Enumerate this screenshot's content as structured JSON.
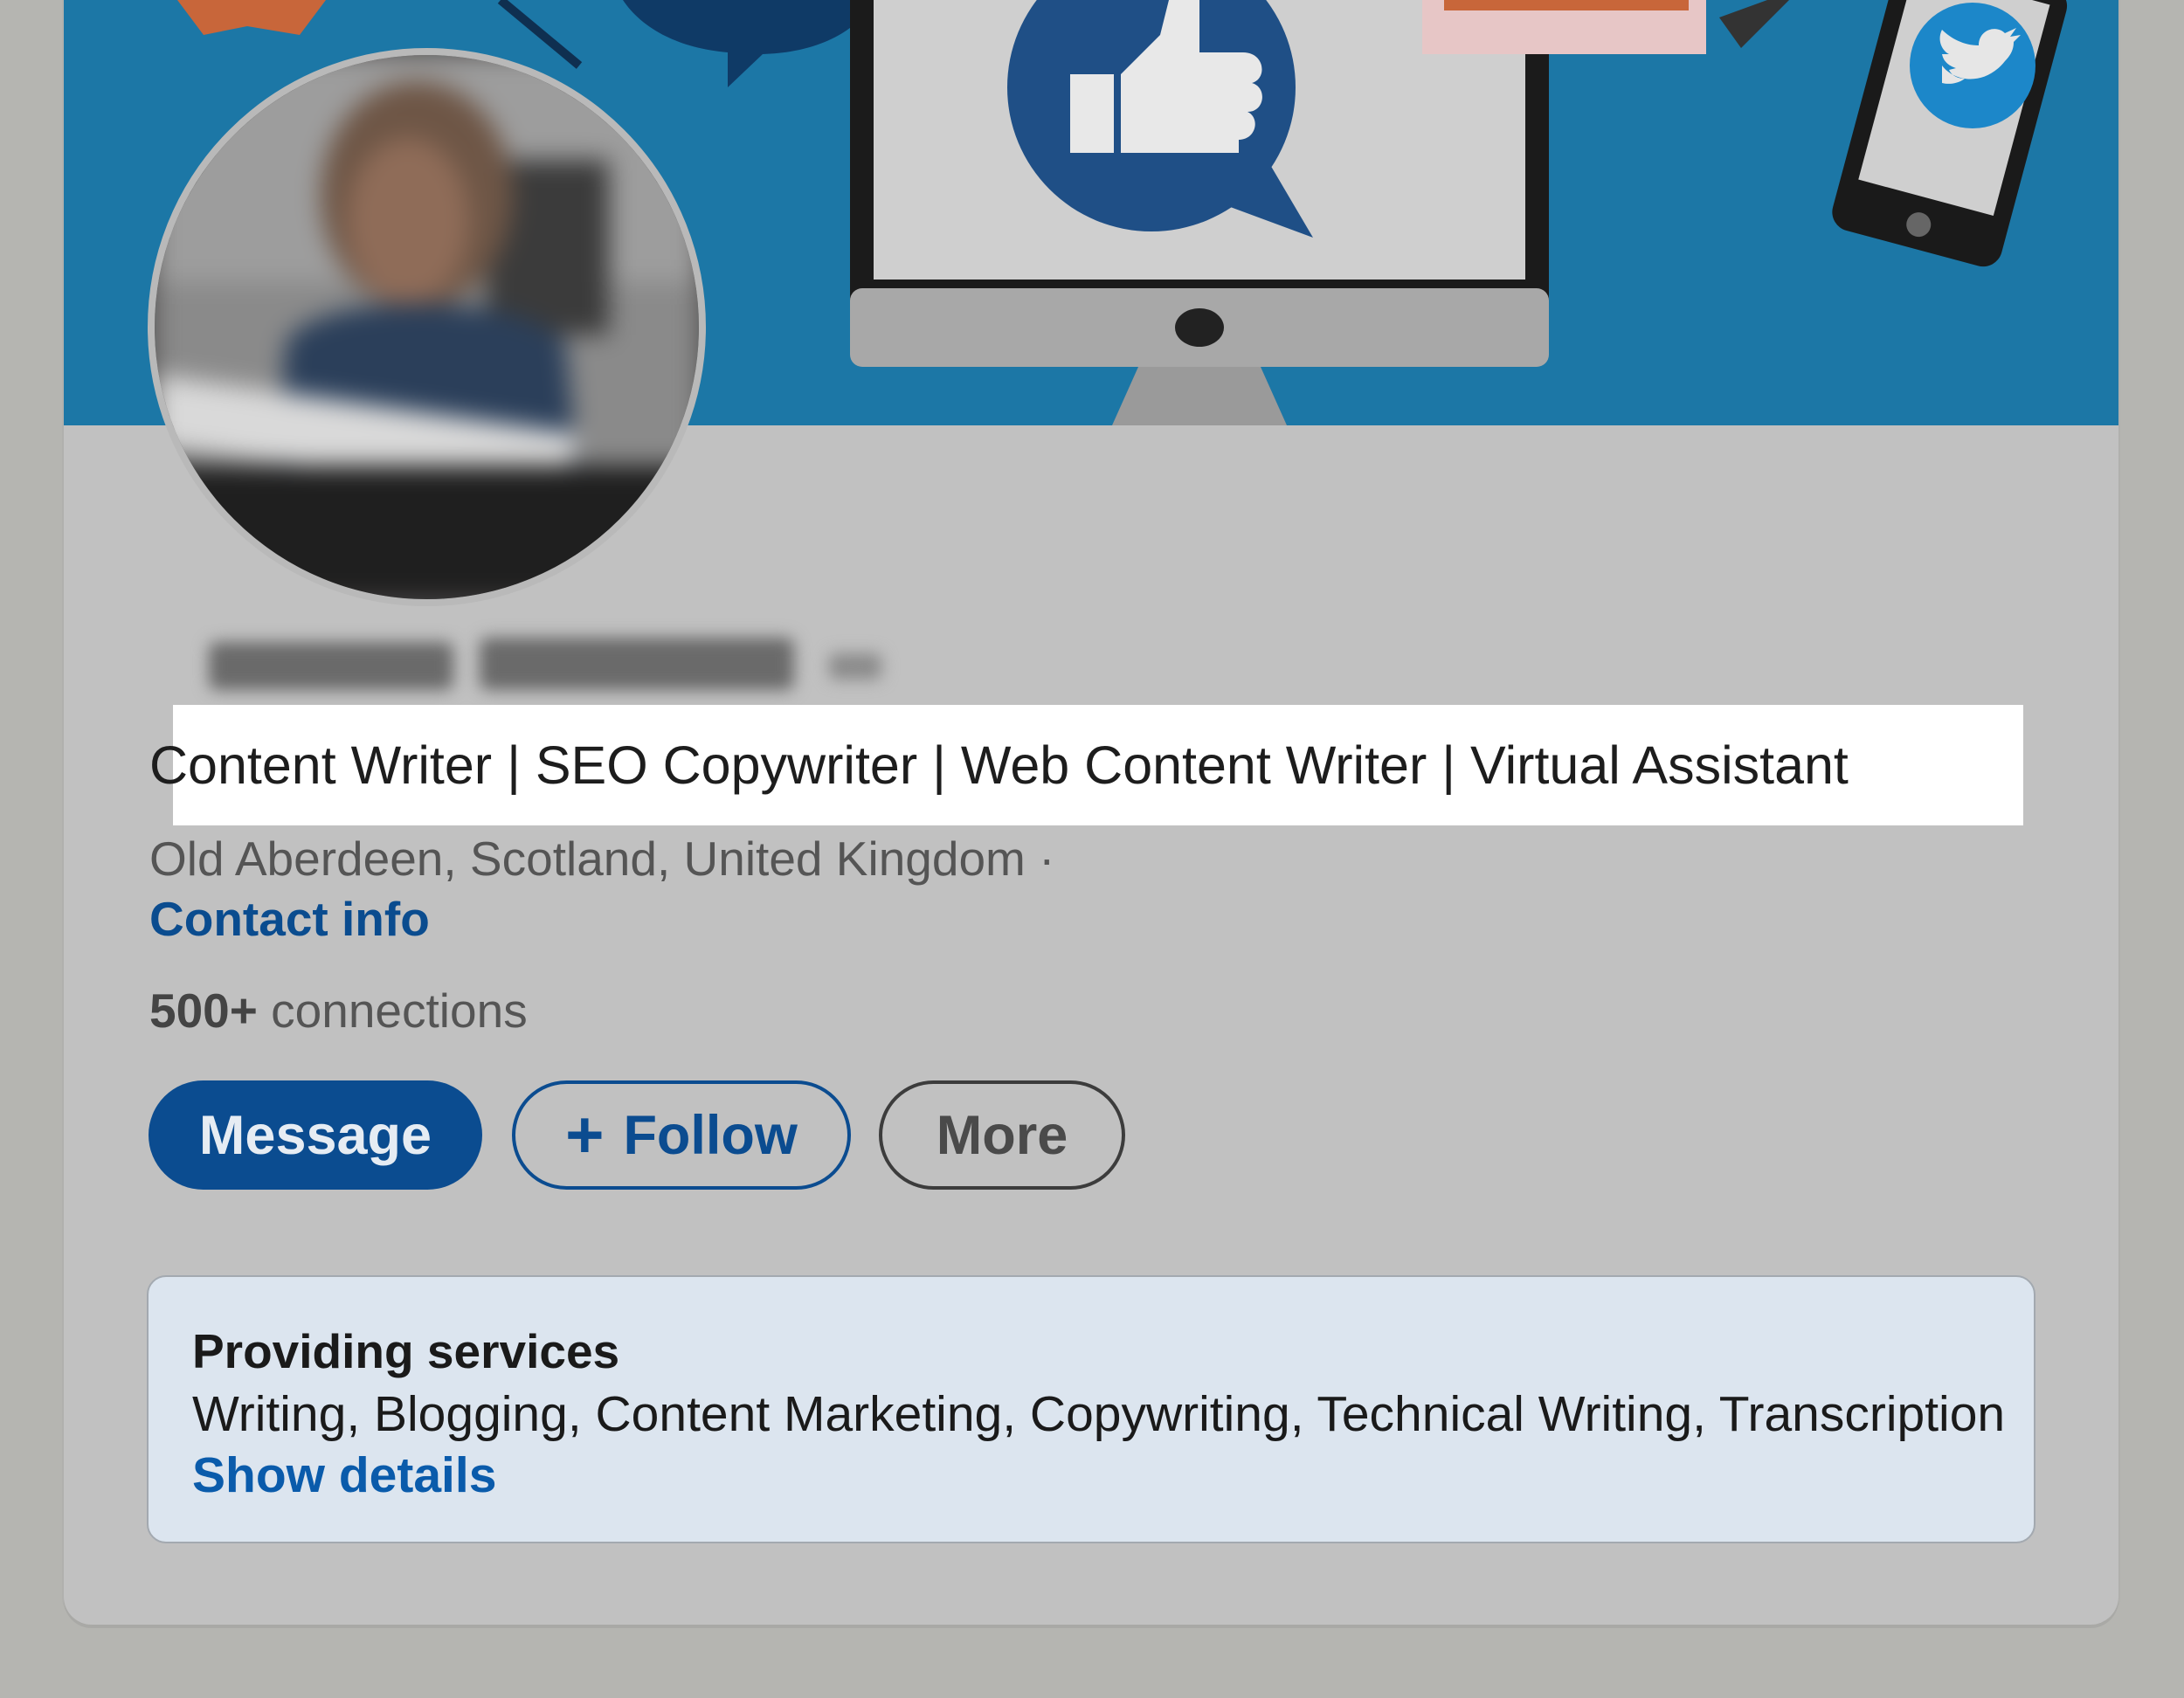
{
  "profile": {
    "headline": "Content Writer | SEO Copywriter | Web Content Writer | Virtual Assistant",
    "location": "Old Aberdeen, Scotland, United Kingdom ·",
    "contact_info": "Contact info",
    "connections_count": "500+",
    "connections_label": " connections"
  },
  "actions": {
    "message": "Message",
    "follow_icon": "+",
    "follow": "Follow",
    "more": "More"
  },
  "services": {
    "title": "Providing services",
    "list": "Writing, Blogging, Content Marketing, Copywriting, Technical Writing, Transcription",
    "show_details": "Show details"
  },
  "colors": {
    "primary": "#0b4c90",
    "banner": "#1c77a6",
    "link": "#0a5bab",
    "services_bg": "#dce5ef"
  },
  "icons": [
    "like-bubble-icon",
    "twitter-bird-icon",
    "plus-icon"
  ]
}
